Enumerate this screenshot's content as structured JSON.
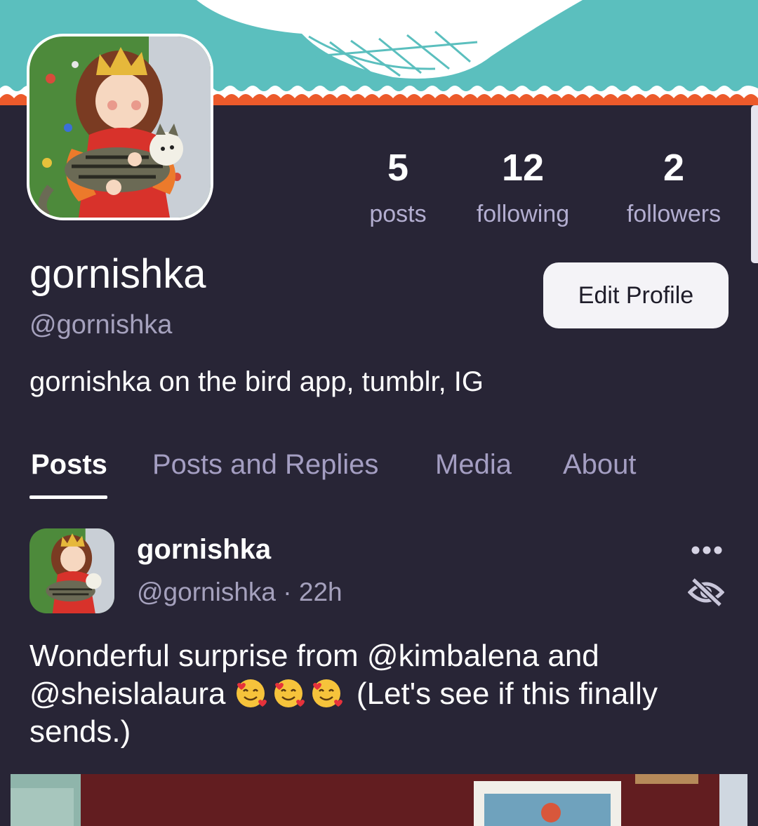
{
  "profile": {
    "display_name": "gornishka",
    "handle": "@gornishka",
    "bio": "gornishka on the bird app, tumblr, IG",
    "edit_button": "Edit Profile"
  },
  "stats": {
    "posts": {
      "count": "5",
      "label": "posts"
    },
    "following": {
      "count": "12",
      "label": "following"
    },
    "followers": {
      "count": "2",
      "label": "followers"
    }
  },
  "tabs": [
    {
      "label": "Posts",
      "active": true
    },
    {
      "label": "Posts and Replies",
      "active": false
    },
    {
      "label": "Media",
      "active": false
    },
    {
      "label": "About",
      "active": false
    }
  ],
  "post": {
    "author": "gornishka",
    "meta": "@gornishka · 22h",
    "text_part1": "Wonderful surprise from @kimbalena and @sheislalaura ",
    "emoji": "smiling-face-with-hearts",
    "text_part2": " (Let's see if this finally sends.)",
    "more_icon": "ellipsis-icon",
    "hidden_icon": "eye-slash-icon"
  },
  "colors": {
    "background": "#282536",
    "banner_teal": "#5bbfbe",
    "banner_orange": "#ec5a2b",
    "muted_text": "#a5a1bd",
    "tab_inactive": "#a49ec2",
    "button_bg": "#f4f3f7"
  }
}
